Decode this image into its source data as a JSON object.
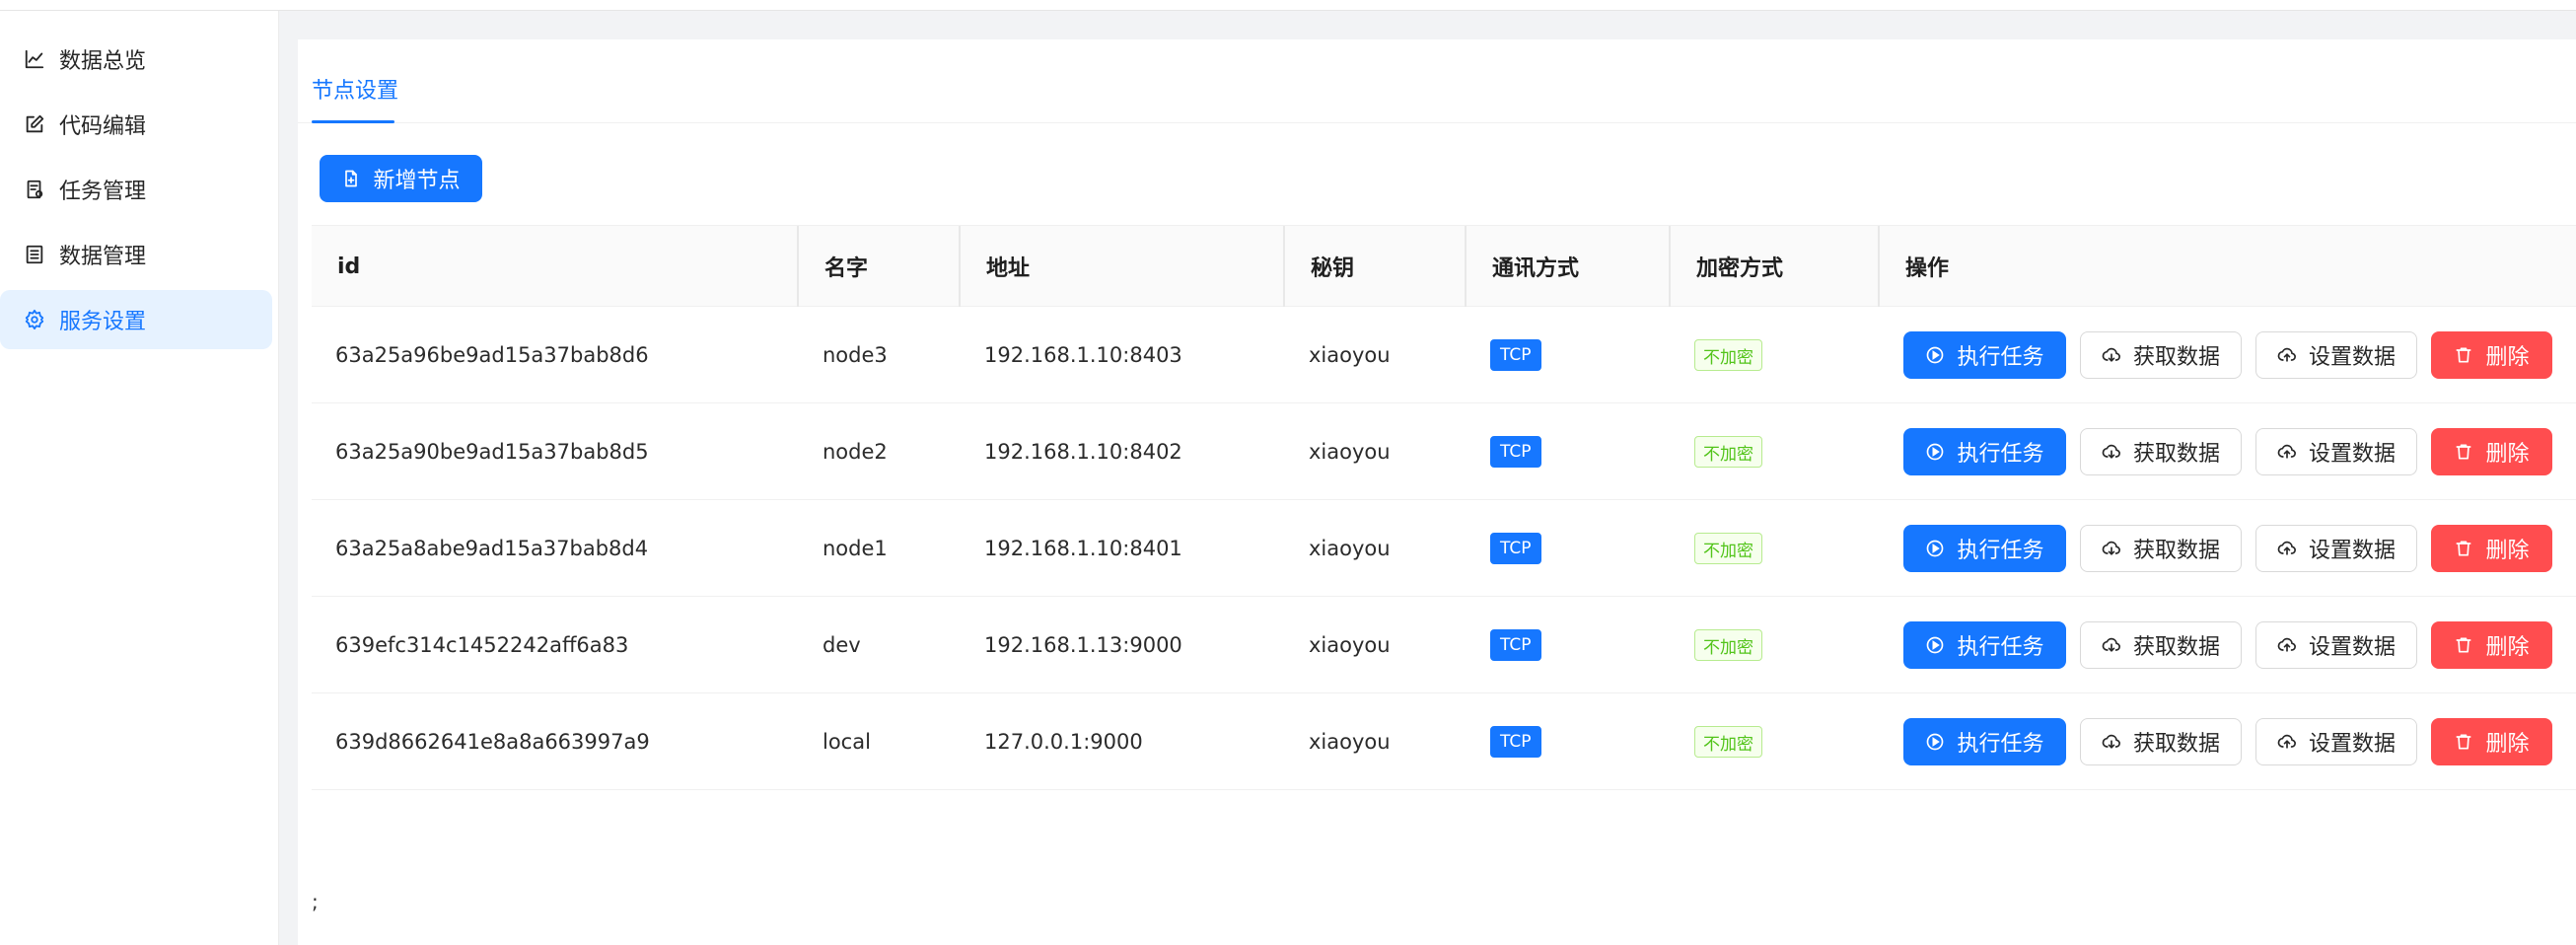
{
  "sidebar": {
    "items": [
      {
        "label": "数据总览",
        "icon": "line-chart-icon"
      },
      {
        "label": "代码编辑",
        "icon": "edit-icon"
      },
      {
        "label": "任务管理",
        "icon": "task-icon"
      },
      {
        "label": "数据管理",
        "icon": "list-icon"
      },
      {
        "label": "服务设置",
        "icon": "gear-icon",
        "active": true
      }
    ]
  },
  "tabs": [
    {
      "label": "节点设置",
      "active": true
    }
  ],
  "toolbar": {
    "add_label": "新增节点"
  },
  "table": {
    "columns": [
      "id",
      "名字",
      "地址",
      "秘钥",
      "通讯方式",
      "加密方式",
      "操作"
    ],
    "rows": [
      {
        "id": "63a25a96be9ad15a37bab8d6",
        "name": "node3",
        "address": "192.168.1.10:8403",
        "key": "xiaoyou",
        "protocol": "TCP",
        "encryption": "不加密"
      },
      {
        "id": "63a25a90be9ad15a37bab8d5",
        "name": "node2",
        "address": "192.168.1.10:8402",
        "key": "xiaoyou",
        "protocol": "TCP",
        "encryption": "不加密"
      },
      {
        "id": "63a25a8abe9ad15a37bab8d4",
        "name": "node1",
        "address": "192.168.1.10:8401",
        "key": "xiaoyou",
        "protocol": "TCP",
        "encryption": "不加密"
      },
      {
        "id": "639efc314c1452242aff6a83",
        "name": "dev",
        "address": "192.168.1.13:9000",
        "key": "xiaoyou",
        "protocol": "TCP",
        "encryption": "不加密"
      },
      {
        "id": "639d8662641e8a8a663997a9",
        "name": "local",
        "address": "127.0.0.1:9000",
        "key": "xiaoyou",
        "protocol": "TCP",
        "encryption": "不加密"
      }
    ],
    "actions": {
      "run": "执行任务",
      "fetch": "获取数据",
      "set": "设置数据",
      "delete": "删除"
    }
  },
  "footer": {
    "mark": ";"
  },
  "colors": {
    "primary": "#1677ff",
    "danger": "#ff4d4f",
    "success": "#52c41a",
    "active_bg": "#e6f2ff"
  }
}
